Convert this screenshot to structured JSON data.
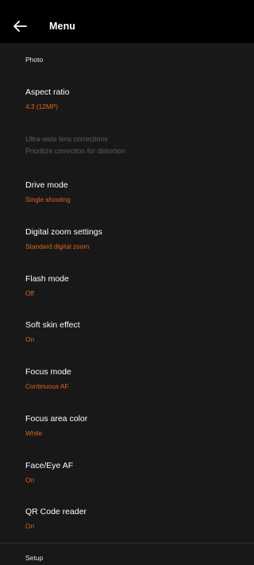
{
  "app_bar": {
    "title": "Menu",
    "back_icon": "arrow-left-icon"
  },
  "colors": {
    "background": "#181818",
    "app_bar": "#000000",
    "accent": "#e2641b",
    "disabled": "#5c5c5c"
  },
  "photo_section": {
    "header": "Photo",
    "items": [
      {
        "title": "Aspect ratio",
        "value": "4:3 (12MP)"
      },
      {
        "title": "Ultra-wide lens corrections",
        "value": "Prioritize correction for distortion",
        "enabled": false
      },
      {
        "title": "Drive mode",
        "value": "Single shooting"
      },
      {
        "title": "Digital zoom settings",
        "value": "Standard digital zoom"
      },
      {
        "title": "Flash mode",
        "value": "Off"
      },
      {
        "title": "Soft skin effect",
        "value": "On"
      },
      {
        "title": "Focus mode",
        "value": "Continuous AF"
      },
      {
        "title": "Focus area color",
        "value": "White"
      },
      {
        "title": "Face/Eye AF",
        "value": "On"
      },
      {
        "title": "QR Code reader",
        "value": "On"
      }
    ]
  },
  "setup_section": {
    "header": "Setup"
  }
}
